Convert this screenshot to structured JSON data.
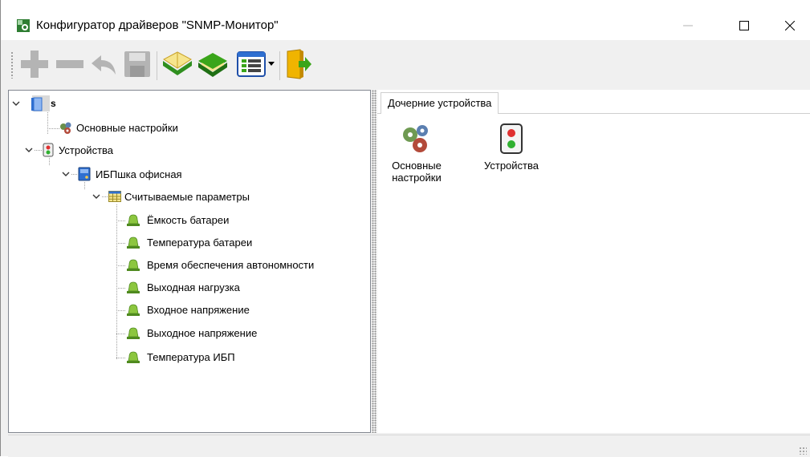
{
  "window": {
    "title": "Конфигуратор драйверов \"SNMP-Монитор\"",
    "app_icon": "app-logo-icon"
  },
  "toolbar": {
    "buttons": [
      {
        "name": "add-button",
        "icon": "plus-icon",
        "enabled": false
      },
      {
        "name": "remove-button",
        "icon": "minus-icon",
        "enabled": false
      },
      {
        "name": "undo-button",
        "icon": "undo-icon",
        "enabled": false
      },
      {
        "name": "save-button",
        "icon": "floppy-icon",
        "enabled": false
      },
      {
        "name": "open-book-button",
        "icon": "open-book-icon",
        "enabled": true
      },
      {
        "name": "closed-book-button",
        "icon": "book-icon",
        "enabled": true
      },
      {
        "name": "view-button",
        "icon": "list-window-icon",
        "enabled": true
      },
      {
        "name": "exit-button",
        "icon": "exit-door-icon",
        "enabled": true
      }
    ]
  },
  "tree": {
    "root": {
      "label": "s"
    },
    "items": [
      {
        "label": "Основные настройки"
      },
      {
        "label": "Устройства"
      },
      {
        "label": "ИБПшка офисная"
      },
      {
        "label": "Считываемые параметры"
      }
    ],
    "params": [
      {
        "label": "Ёмкость батареи"
      },
      {
        "label": "Температура батареи"
      },
      {
        "label": "Время обеспечения автономности"
      },
      {
        "label": "Выходная нагрузка"
      },
      {
        "label": "Входное напряжение"
      },
      {
        "label": "Выходное напряжение"
      },
      {
        "label": "Температура ИБП"
      }
    ]
  },
  "right_pane": {
    "tab_label": "Дочерние устройства",
    "children": [
      {
        "label_line1": "Основные",
        "label_line2": "настройки",
        "icon": "gears-icon"
      },
      {
        "label_line1": "Устройства",
        "label_line2": "",
        "icon": "traffic-light-icon"
      }
    ]
  },
  "colors": {
    "accent_green": "#3aa51a",
    "disabled_gray": "#b4b4b4",
    "selection": "#d9d9d9"
  }
}
